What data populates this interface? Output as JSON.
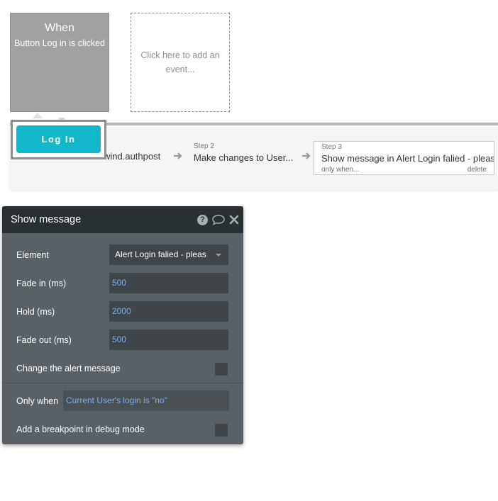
{
  "event": {
    "when_label": "When",
    "description": "Button Log in is clicked"
  },
  "add_event": {
    "label": "Click here to add an event..."
  },
  "login_button": {
    "label": "Log In"
  },
  "steps": [
    {
      "title": "wind.authpost"
    },
    {
      "number": "Step 2",
      "title": "Make changes to User..."
    },
    {
      "number": "Step 3",
      "title": "Show message in Alert Login falied - pleas",
      "condition_link": "only when...",
      "delete_label": "delete"
    }
  ],
  "panel": {
    "title": "Show message",
    "icons": [
      "help-icon",
      "comment-icon",
      "close-icon"
    ],
    "fields": {
      "element": {
        "label": "Element",
        "value": "Alert Login falied - pleas"
      },
      "fade_in": {
        "label": "Fade in (ms)",
        "value": "500"
      },
      "hold": {
        "label": "Hold (ms)",
        "value": "2000"
      },
      "fade_out": {
        "label": "Fade out (ms)",
        "value": "500"
      },
      "change_alert": {
        "label": "Change the alert message",
        "checked": false
      },
      "only_when": {
        "label": "Only when",
        "value": "Current User's login is \"no\""
      },
      "breakpoint": {
        "label": "Add a breakpoint in debug mode",
        "checked": false
      }
    }
  },
  "colors": {
    "accent": "#12b7c9",
    "panel_bg": "#5a6166",
    "panel_header": "#283034",
    "value_text": "#7ab1ee"
  }
}
